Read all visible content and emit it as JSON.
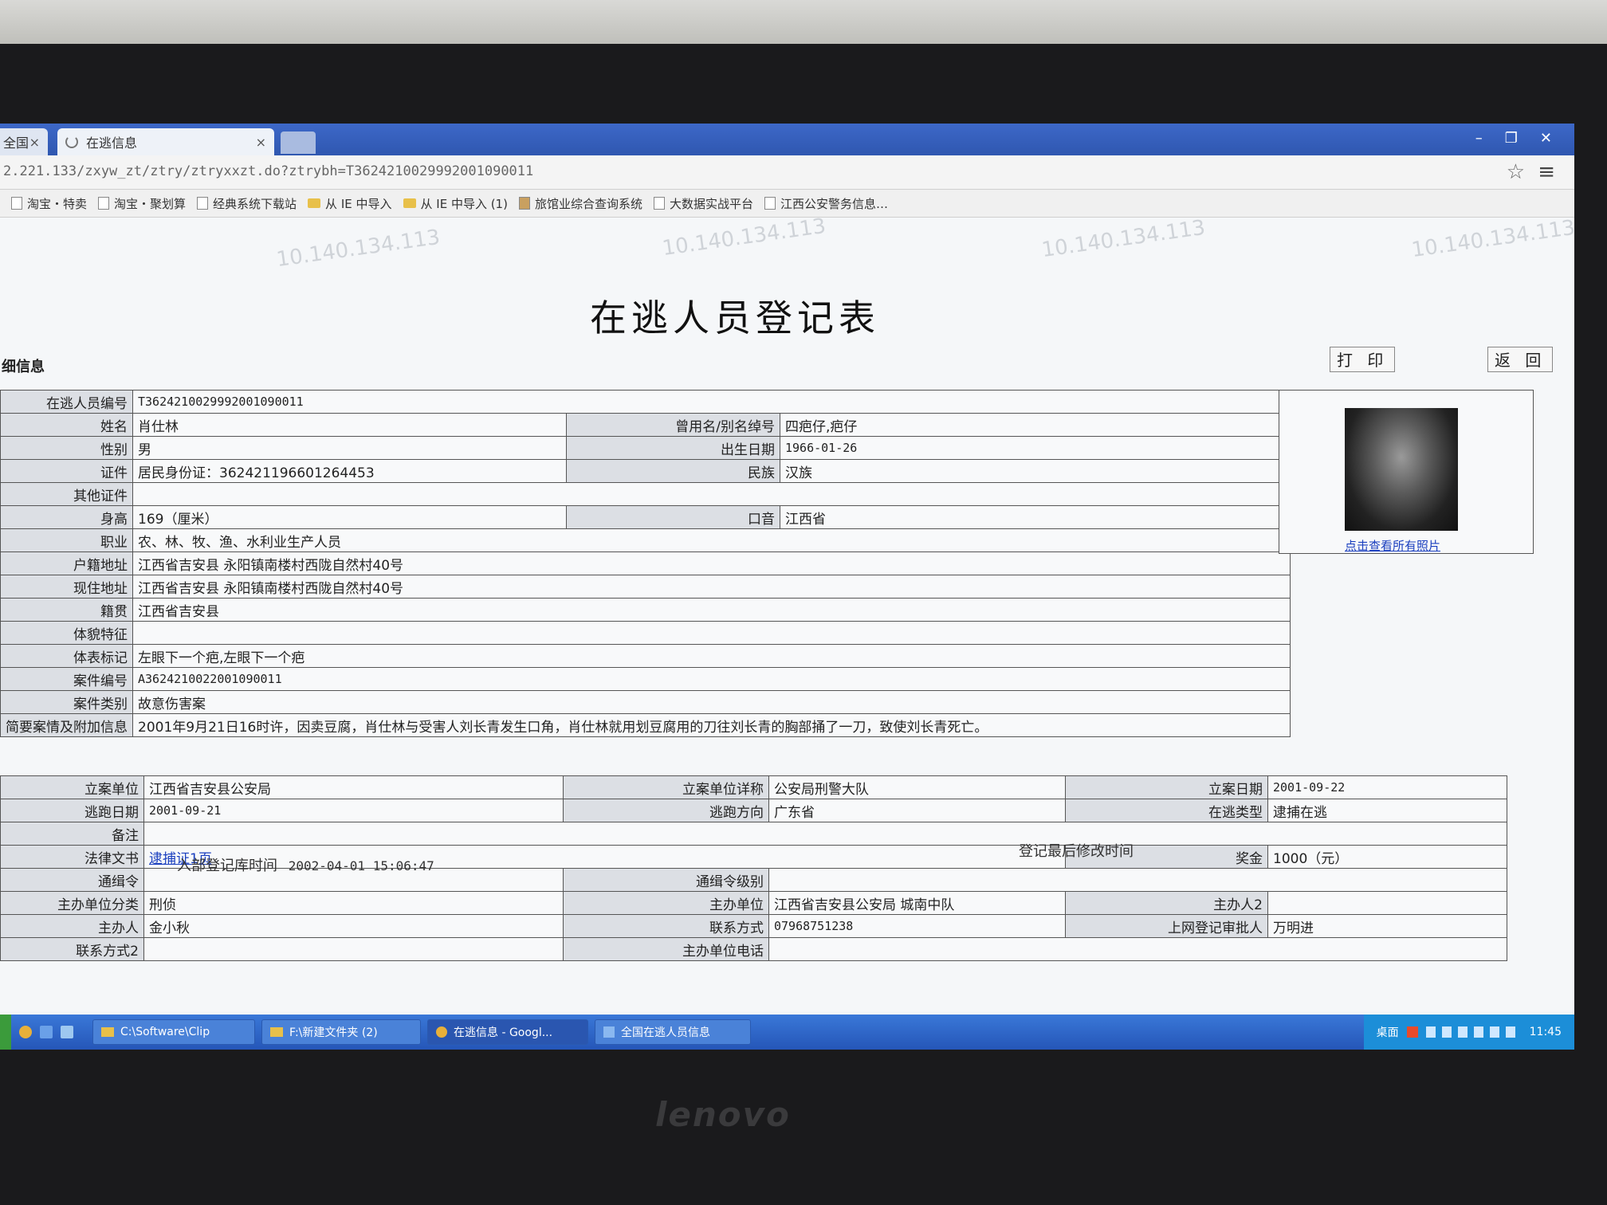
{
  "browser": {
    "tabs": [
      {
        "label": "全国",
        "close": "×"
      },
      {
        "label": "在逃信息",
        "close": "×"
      }
    ],
    "window_controls": [
      "–",
      "❐",
      "✕"
    ],
    "url": "2.221.133/zxyw_zt/ztry/ztryxxzt.do?ztrybh=T3624210029992001090011",
    "bookmarks": [
      "淘宝・特卖",
      "淘宝・聚划算",
      "经典系统下载站",
      "从 IE 中导入",
      "从 IE 中导入 (1)",
      "旅馆业综合查询系统",
      "大数据实战平台",
      "江西公安警务信息…"
    ]
  },
  "page": {
    "watermark": "10.140.134.113",
    "title": "在逃人员登记表",
    "section": "细信息",
    "print_label": "打 印",
    "back_label": "返 回",
    "photo_link": "点击查看所有照片"
  },
  "form": {
    "labels": {
      "id": "在逃人员编号",
      "name": "姓名",
      "alias": "曾用名/别名绰号",
      "sex": "性别",
      "birth": "出生日期",
      "cert": "证件",
      "nation": "民族",
      "other_cert": "其他证件",
      "height": "身高",
      "accent": "口音",
      "job": "职业",
      "hukou": "户籍地址",
      "address": "现住地址",
      "native": "籍贯",
      "physique": "体貌特征",
      "marks": "体表标记",
      "case_no": "案件编号",
      "case_type": "案件类别",
      "brief": "简要案情及附加信息",
      "case_unit": "立案单位",
      "case_unit_full": "立案单位详称",
      "case_date": "立案日期",
      "flee_date": "逃跑日期",
      "flee_dir": "逃跑方向",
      "flee_type": "在逃类型",
      "remark": "备注",
      "legal_doc": "法律文书",
      "reward": "奖金",
      "wanted_order": "通缉令",
      "wanted_level": "通缉令级别",
      "host_class": "主办单位分类",
      "host_unit": "主办单位",
      "host_person2": "主办人2",
      "host_person": "主办人",
      "contact": "联系方式",
      "approver": "上网登记审批人",
      "contact2": "联系方式2",
      "host_phone": "主办单位电话"
    },
    "values": {
      "id": "T3624210029992001090011",
      "name": "肖仕林",
      "alias": "四疤仔,疤仔",
      "sex": "男",
      "birth": "1966-01-26",
      "cert": "居民身份证：362421196601264453",
      "nation": "汉族",
      "other_cert": "",
      "height": "169（厘米）",
      "accent": "江西省",
      "job": "农、林、牧、渔、水利业生产人员",
      "hukou": "江西省吉安县 永阳镇南楼村西陇自然村40号",
      "address": "江西省吉安县 永阳镇南楼村西陇自然村40号",
      "native": "江西省吉安县",
      "physique": "",
      "marks": "左眼下一个疤,左眼下一个疤",
      "case_no": "A3624210022001090011",
      "case_type": "故意伤害案",
      "brief": "2001年9月21日16时许，因卖豆腐，肖仕林与受害人刘长青发生口角，肖仕林就用划豆腐用的刀往刘长青的胸部捅了一刀，致使刘长青死亡。",
      "case_unit": "江西省吉安县公安局",
      "case_unit_full": "公安局刑警大队",
      "case_date": "2001-09-22",
      "flee_date": "2001-09-21",
      "flee_dir": "广东省",
      "flee_type": "逮捕在逃",
      "remark": "",
      "legal_doc": "逮捕证1页",
      "reward": "1000（元）",
      "wanted_order": "",
      "wanted_level": "",
      "host_class": "刑侦",
      "host_unit": "江西省吉安县公安局 城南中队",
      "host_person2": "",
      "host_person": "金小秋",
      "contact": "07968751238",
      "approver": "万明进",
      "contact2": "",
      "host_phone": ""
    }
  },
  "footer": {
    "entry_time_label": "入部登记库时间",
    "entry_time": "2002-04-01 15:06:47",
    "modify_label": "登记最后修改时间"
  },
  "taskbar": {
    "tasks": [
      "C:\\Software\\Clip",
      "F:\\新建文件夹 (2)",
      "在逃信息 - Googl...",
      "全国在逃人员信息"
    ],
    "tray_desktop": "桌面",
    "clock": "11:45"
  },
  "monitor": {
    "brand": "lenovo"
  }
}
